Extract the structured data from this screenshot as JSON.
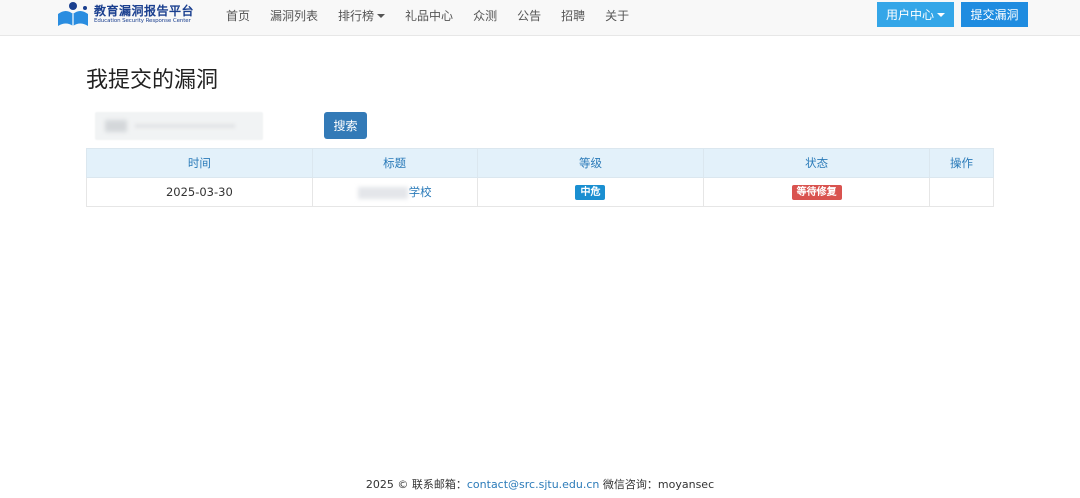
{
  "brand": {
    "name_cn": "教育漏洞报告平台",
    "name_en": "Education Security Response Center",
    "accent": "#1a3f8f"
  },
  "nav": {
    "items": [
      {
        "label": "首页",
        "icon": ""
      },
      {
        "label": "漏洞列表",
        "icon": ""
      },
      {
        "label": "排行榜",
        "icon": "caret-down-icon"
      },
      {
        "label": "礼品中心",
        "icon": ""
      },
      {
        "label": "众测",
        "icon": ""
      },
      {
        "label": "公告",
        "icon": ""
      },
      {
        "label": "招聘",
        "icon": ""
      },
      {
        "label": "关于",
        "icon": ""
      }
    ],
    "user_center_label": "用户中心",
    "submit_label": "提交漏洞"
  },
  "page": {
    "title": "我提交的漏洞"
  },
  "search": {
    "button_label": "搜索"
  },
  "table": {
    "headers": [
      "时间",
      "标题",
      "等级",
      "状态",
      "操作"
    ],
    "rows": [
      {
        "time": "2025-03-30",
        "title_visible": "学校",
        "level": "中危",
        "status": "等待修复",
        "action": ""
      }
    ]
  },
  "footer": {
    "prefix": "2025 © 联系邮箱：",
    "email": "contact@src.sjtu.edu.cn",
    "wechat": " 微信咨询：moyansec"
  },
  "colors": {
    "primary_button": "#337ab7",
    "user_center_button": "#34a6e8",
    "submit_button": "#1f8ce0",
    "level_badge": "#1a8fd1",
    "status_badge": "#d9534f",
    "table_header_bg": "#e3f1fa"
  }
}
